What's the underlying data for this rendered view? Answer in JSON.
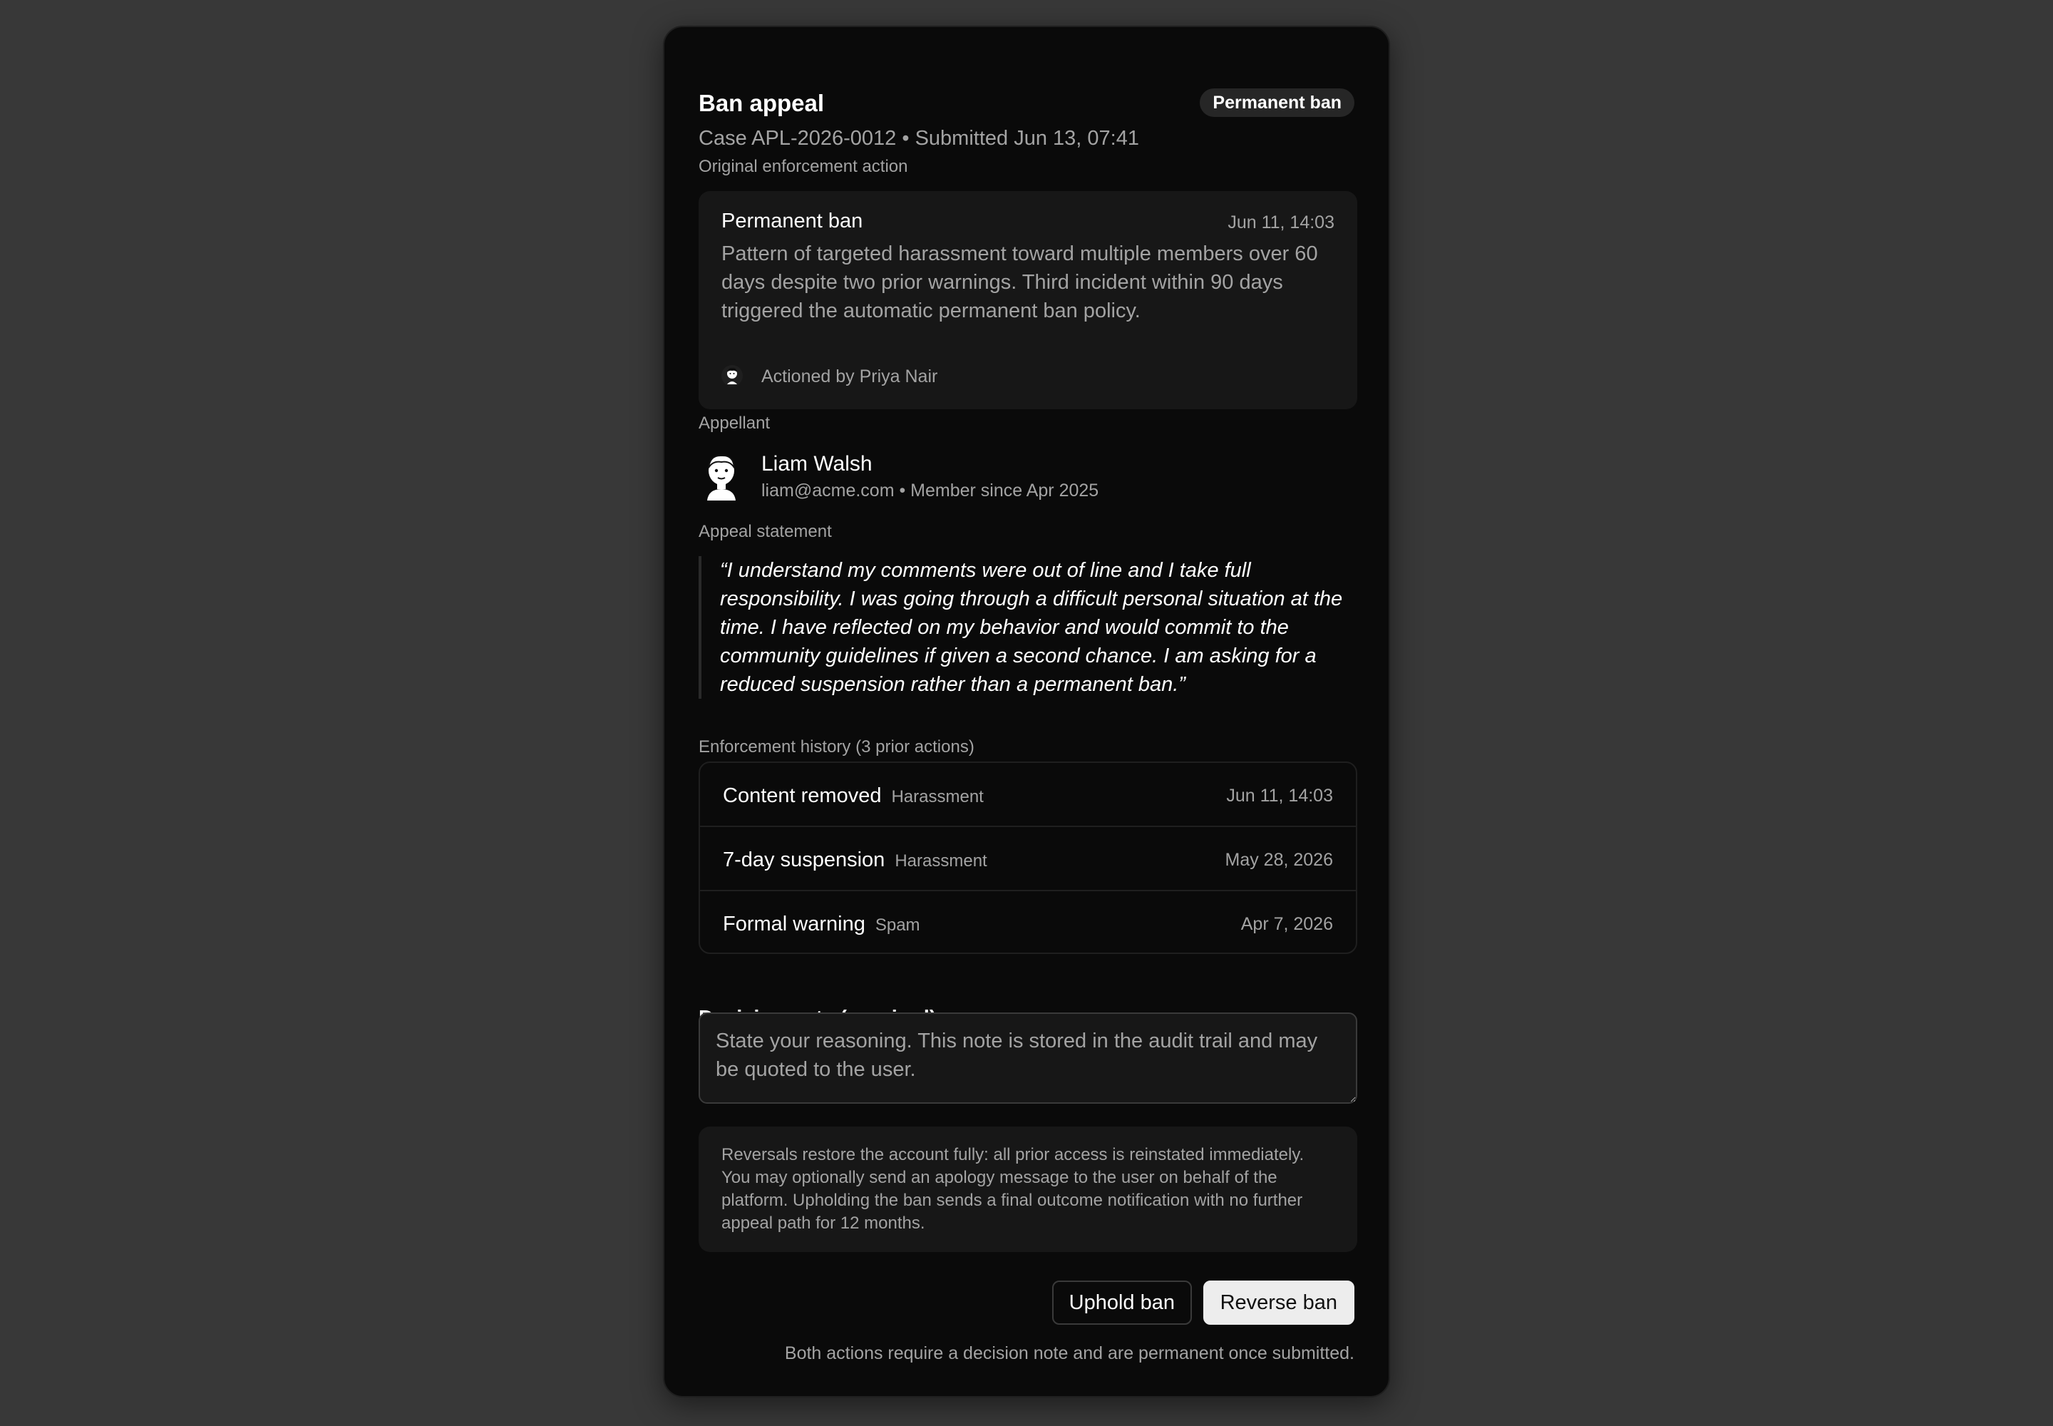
{
  "header": {
    "title": "Ban appeal",
    "subtitle": "Case APL-2026-0012 • Submitted Jun 13, 07:41",
    "badge": "Permanent ban"
  },
  "original_action": {
    "section_label": "Original enforcement action",
    "title": "Permanent ban",
    "date": "Jun 11, 14:03",
    "description": "Pattern of targeted harassment toward multiple members over 60 days despite two prior warnings. Third incident within 90 days triggered the automatic permanent ban policy.",
    "actioned_by": "Actioned by Priya Nair"
  },
  "appellant": {
    "section_label": "Appellant",
    "name": "Liam Walsh",
    "meta": "liam@acme.com • Member since Apr 2025"
  },
  "statement": {
    "section_label": "Appeal statement",
    "text": "“I understand my comments were out of line and I take full responsibility. I was going through a difficult personal situation at the time. I have reflected on my behavior and would commit to the community guidelines if given a second chance. I am asking for a reduced suspension rather than a permanent ban.”"
  },
  "history": {
    "section_label": "Enforcement history (3 prior actions)",
    "rows": [
      {
        "title": "Content removed",
        "category": "Harassment",
        "date": "Jun 11, 14:03"
      },
      {
        "title": "7-day suspension",
        "category": "Harassment",
        "date": "May 28, 2026"
      },
      {
        "title": "Formal warning",
        "category": "Spam",
        "date": "Apr 7, 2026"
      }
    ]
  },
  "decision": {
    "label": "Decision note (required)",
    "placeholder": "State your reasoning. This note is stored in the audit trail and may be quoted to the user.",
    "value": ""
  },
  "info": {
    "text": "Reversals restore the account fully: all prior access is reinstated immediately. You may optionally send an apology message to the user on behalf of the platform. Upholding the ban sends a final outcome notification with no further appeal path for 12 months."
  },
  "actions": {
    "uphold_label": "Uphold ban",
    "reverse_label": "Reverse ban",
    "footer_note": "Both actions require a decision note and are permanent once submitted."
  },
  "colors": {
    "page_bg": "#383838",
    "card_bg": "#0a0a0a",
    "surface": "#171717",
    "muted_text": "#a3a3a3",
    "primary_button": "#ededed"
  },
  "icons": {
    "moderator_avatar": "moderator-avatar-icon",
    "appellant_avatar": "appellant-avatar-icon"
  }
}
